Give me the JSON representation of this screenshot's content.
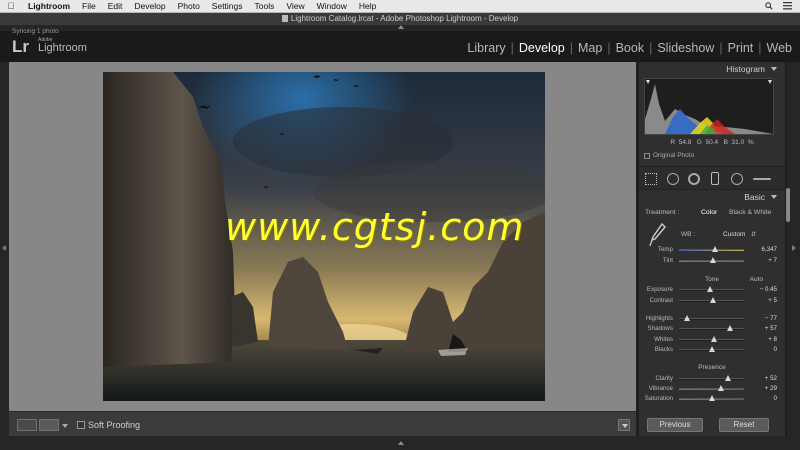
{
  "menubar": {
    "app": "Lightroom",
    "items": [
      "File",
      "Edit",
      "Develop",
      "Photo",
      "Settings",
      "Tools",
      "View",
      "Window",
      "Help"
    ]
  },
  "window_title": "Lightroom Catalog.lrcat - Adobe Photoshop Lightroom - Develop",
  "identity": {
    "sync_status": "Syncing 1 photo",
    "logo": "Lr",
    "brand_small": "Adobe",
    "brand": "Lightroom"
  },
  "modules": [
    "Library",
    "Develop",
    "Map",
    "Book",
    "Slideshow",
    "Print",
    "Web"
  ],
  "active_module": "Develop",
  "toolbar": {
    "soft_proofing": "Soft Proofing"
  },
  "panel": {
    "histogram_title": "Histogram",
    "hist_r_label": "R",
    "hist_r": "54.8",
    "hist_g_label": "G",
    "hist_g": "50.4",
    "hist_b_label": "B",
    "hist_b": "31.0",
    "hist_unit": "%",
    "original_photo": "Original Photo",
    "basic_title": "Basic",
    "treatment_label": "Treatment :",
    "treatment_color": "Color",
    "treatment_bw": "Black & White",
    "wb_label": "WB :",
    "wb_value": "Custom",
    "tone_label": "Tone",
    "auto_label": "Auto",
    "presence_label": "Presence",
    "sliders": [
      {
        "label": "Temp",
        "value": "6,347",
        "pos": 0.55
      },
      {
        "label": "Tint",
        "value": "+ 7",
        "pos": 0.53
      },
      {
        "label": "Exposure",
        "value": "− 0.45",
        "pos": 0.47
      },
      {
        "label": "Contrast",
        "value": "+ 5",
        "pos": 0.52
      },
      {
        "label": "Highlights",
        "value": "− 77",
        "pos": 0.12
      },
      {
        "label": "Shadows",
        "value": "+ 57",
        "pos": 0.78
      },
      {
        "label": "Whites",
        "value": "+ 8",
        "pos": 0.54
      },
      {
        "label": "Blacks",
        "value": "0",
        "pos": 0.5
      },
      {
        "label": "Clarity",
        "value": "+ 52",
        "pos": 0.76
      },
      {
        "label": "Vibrance",
        "value": "+ 29",
        "pos": 0.65
      },
      {
        "label": "Saturation",
        "value": "0",
        "pos": 0.5
      }
    ],
    "previous_button": "Previous",
    "reset_button": "Reset"
  },
  "watermark": "www.cgtsj.com",
  "colors": {
    "accent": "#ffffff",
    "panel_bg": "#2f2f2f",
    "canvas_bg": "#878787",
    "watermark": "#ffff30"
  }
}
